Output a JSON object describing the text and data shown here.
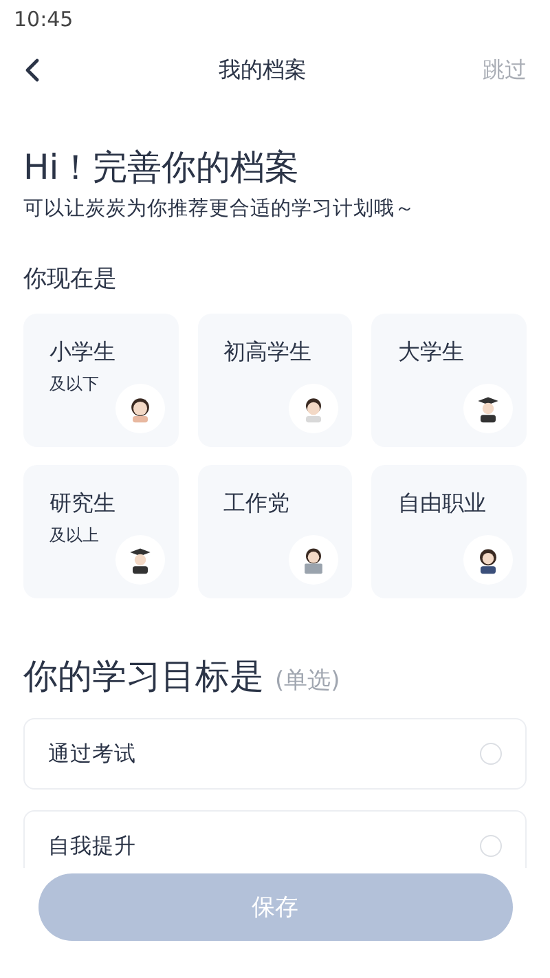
{
  "status_bar": {
    "time": "10:45"
  },
  "header": {
    "title": "我的档案",
    "skip": "跳过"
  },
  "intro": {
    "title": "Hi！完善你的档案",
    "subtitle": "可以让炭炭为你推荐更合适的学习计划哦～"
  },
  "identity": {
    "label": "你现在是",
    "options": [
      {
        "name": "小学生",
        "note": "及以下",
        "kind": "child",
        "selected": false
      },
      {
        "name": "初高学生",
        "kind": "teen",
        "selected": false
      },
      {
        "name": "大学生",
        "kind": "graduate",
        "selected": false
      },
      {
        "name": "研究生",
        "note": "及以上",
        "kind": "graduate",
        "selected": false
      },
      {
        "name": "工作党",
        "kind": "laptop",
        "selected": false
      },
      {
        "name": "自由职业",
        "kind": "worker",
        "selected": false
      }
    ]
  },
  "goal": {
    "label": "你的学习目标是",
    "hint": "(单选)",
    "options": [
      {
        "name": "通过考试",
        "selected": false
      },
      {
        "name": "自我提升",
        "selected": false
      }
    ]
  },
  "save_button": {
    "label": "保存",
    "disabled": true
  }
}
